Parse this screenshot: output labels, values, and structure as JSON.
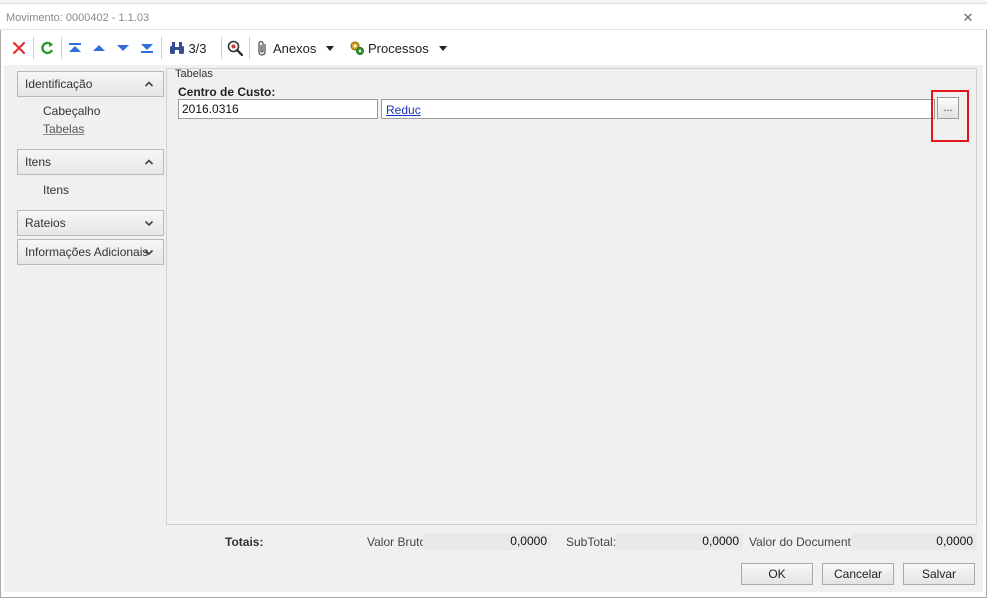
{
  "window": {
    "title": "Movimento: 0000402 - 1.1.03",
    "close_glyph": "✕"
  },
  "toolbar": {
    "record_counter": "3/3",
    "anexos_label": "Anexos",
    "processos_label": "Processos",
    "icons": [
      "delete-icon",
      "refresh-icon",
      "first-record-icon",
      "previous-record-icon",
      "next-record-icon",
      "last-record-icon",
      "binoculars-icon",
      "zoom-icon",
      "paperclip-icon",
      "processes-icon"
    ]
  },
  "nav": {
    "sections": [
      {
        "label": "Identificação",
        "expanded": true,
        "items": [
          "Cabeçalho",
          "Tabelas"
        ]
      },
      {
        "label": "Itens",
        "expanded": true,
        "items": [
          "Itens"
        ]
      },
      {
        "label": "Rateios",
        "expanded": false,
        "items": []
      },
      {
        "label": "Informações Adicionais",
        "expanded": false,
        "items": []
      }
    ]
  },
  "content": {
    "group_title": "Tabelas",
    "centro_custo_label": "Centro de Custo:",
    "centro_custo_code": "2016.0316",
    "centro_custo_desc": "Reduc",
    "browse_label": "..."
  },
  "totals": {
    "label": "Totais:",
    "valor_bruto_label": "Valor Bruto:",
    "valor_bruto": "0,0000",
    "subtotal_label": "SubTotal:",
    "subtotal": "0,0000",
    "valor_documento_label": "Valor do Documento:",
    "valor_documento": "0,0000"
  },
  "buttons": {
    "ok": "OK",
    "cancelar": "Cancelar",
    "salvar": "Salvar"
  },
  "colors": {
    "highlight": "#e0151b",
    "link": "#1a33b8",
    "delete": "#e03030",
    "refresh": "#2a9a2a",
    "nav_arrows": "#2d6fd6"
  }
}
